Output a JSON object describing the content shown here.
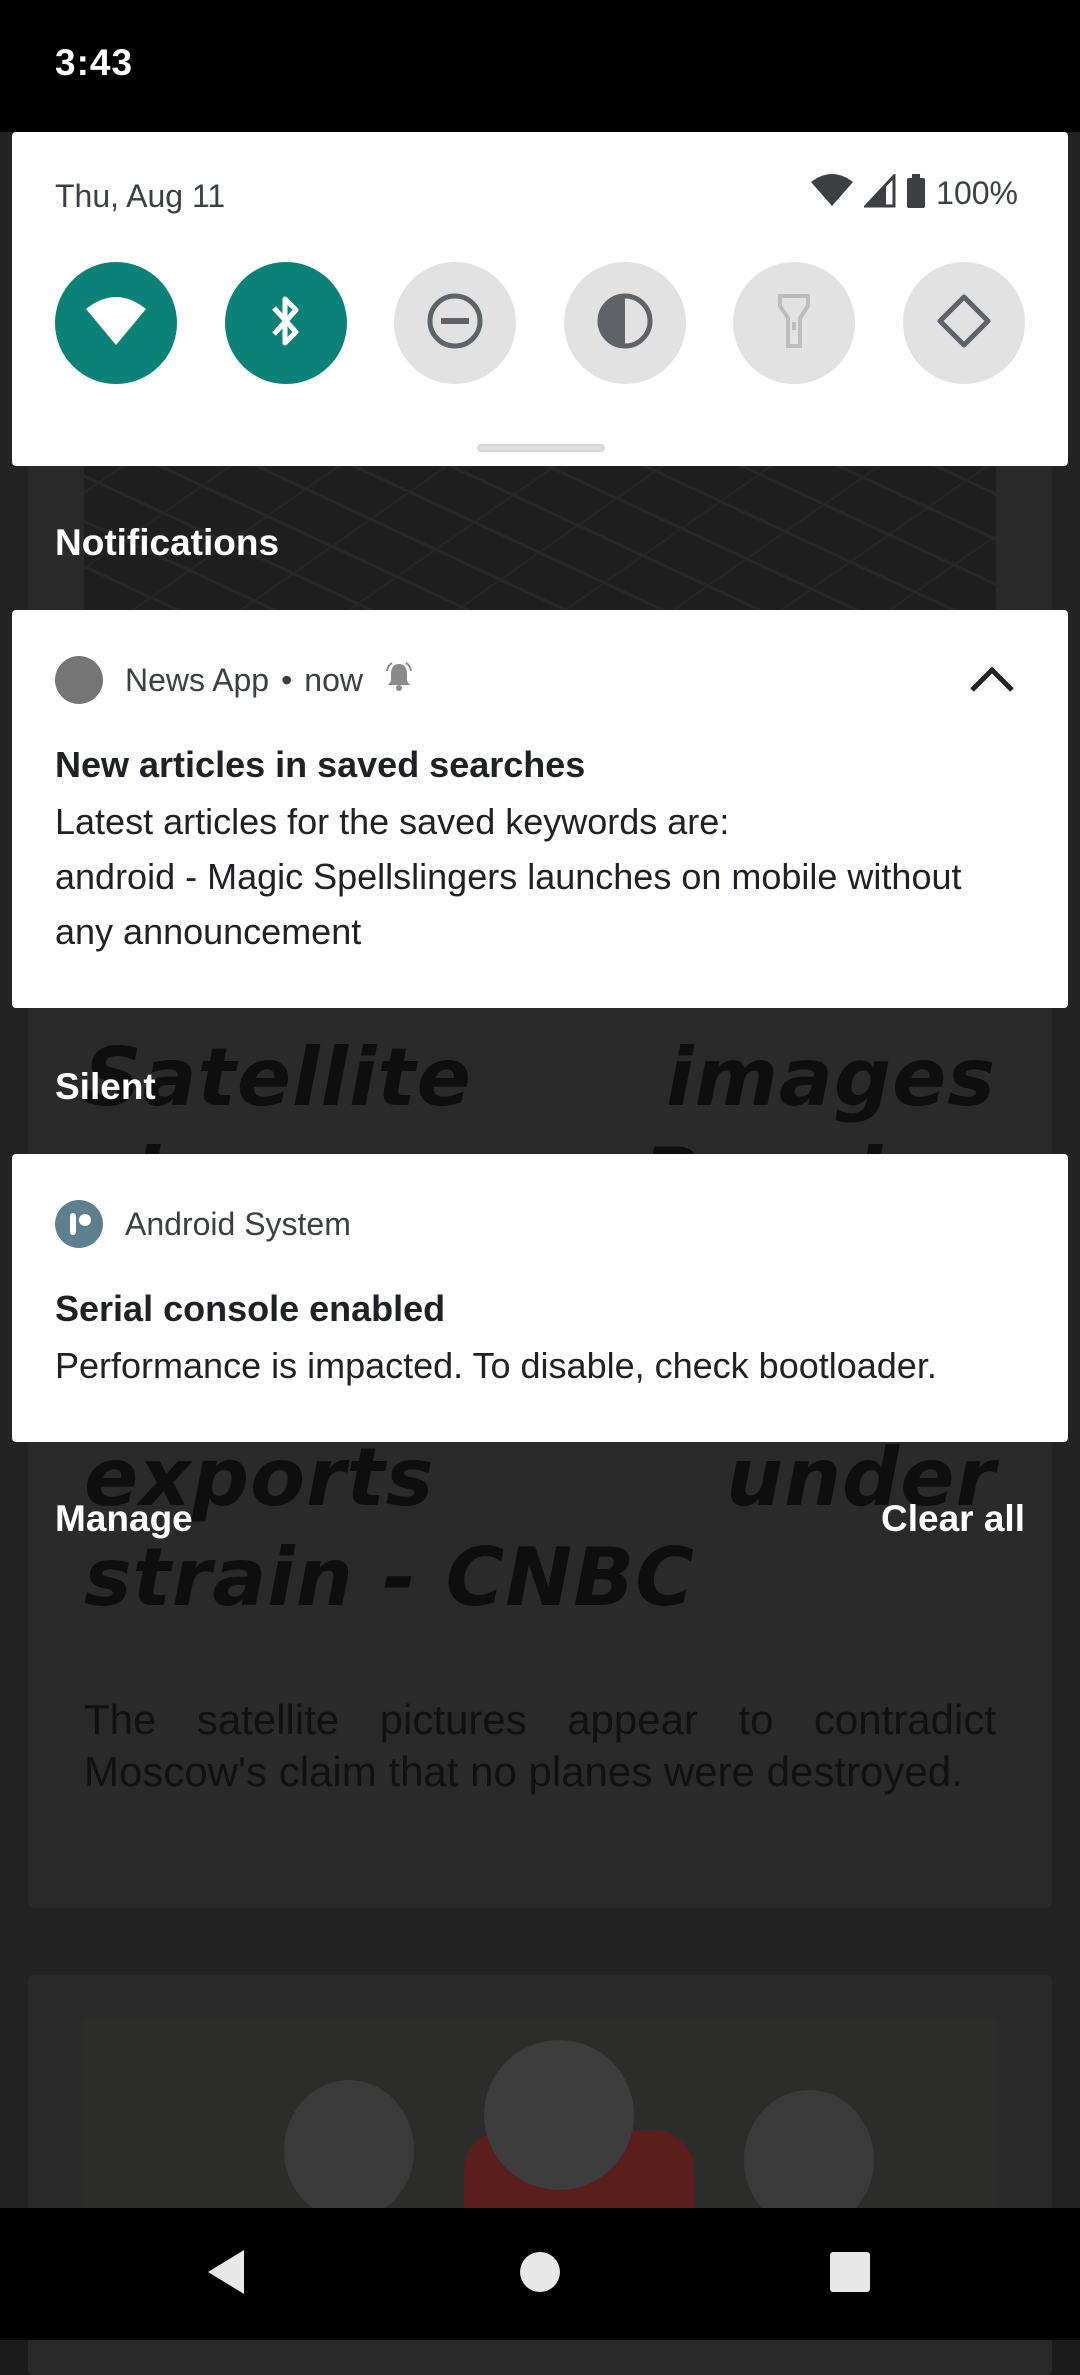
{
  "status_bar": {
    "time": "3:43"
  },
  "quick_settings": {
    "date": "Thu, Aug 11",
    "battery_percent": "100%",
    "tiles": [
      {
        "name": "wifi",
        "icon": "wifi-icon",
        "active": true
      },
      {
        "name": "bluetooth",
        "icon": "bluetooth-icon",
        "active": true
      },
      {
        "name": "do-not-disturb",
        "icon": "do-not-disturb-icon",
        "active": false
      },
      {
        "name": "dark-theme",
        "icon": "dark-theme-icon",
        "active": false
      },
      {
        "name": "flashlight",
        "icon": "flashlight-icon",
        "active": false
      },
      {
        "name": "auto-rotate",
        "icon": "auto-rotate-icon",
        "active": false
      }
    ],
    "accent_color": "#0b8177"
  },
  "sections": {
    "notifications": "Notifications",
    "silent": "Silent"
  },
  "notification_news": {
    "app_name": "News App",
    "time": "now",
    "title": "New articles in saved searches",
    "body_line1": "Latest articles for the saved keywords are:",
    "body_line2": "android - Magic Spellslingers launches on mobile without any announcement"
  },
  "notification_system": {
    "app_name": "Android System",
    "title": "Serial console enabled",
    "body": "Performance is impacted. To disable, check bootloader."
  },
  "footer": {
    "manage": "Manage",
    "clear_all": "Clear all"
  },
  "background": {
    "headline": "Satellite images show Russian warplanes destroyed as exports under strain - CNBC",
    "summary": "The satellite pictures appear to contradict Moscow's claim that no planes were destroyed."
  }
}
